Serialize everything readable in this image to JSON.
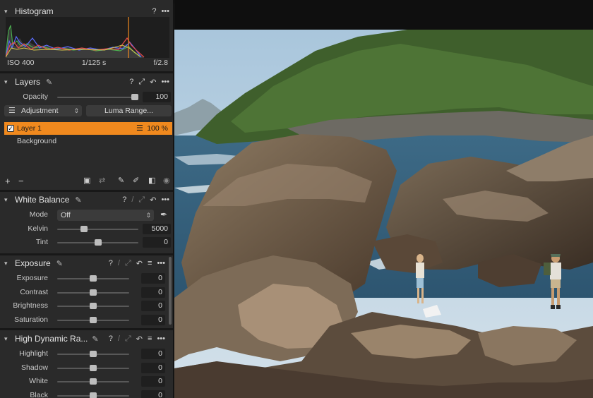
{
  "histogram": {
    "title": "Histogram",
    "iso": "ISO 400",
    "shutter": "1/125 s",
    "aperture": "f/2.8"
  },
  "layers": {
    "title": "Layers",
    "opacity_label": "Opacity",
    "opacity_value": "100",
    "opacity_level": 1.0,
    "adjustment_label": "Adjustment",
    "luma_label": "Luma Range...",
    "items": [
      {
        "name": "Layer 1",
        "value": "100 %",
        "active": true,
        "checked": true
      },
      {
        "name": "Background",
        "active": false
      }
    ]
  },
  "white_balance": {
    "title": "White Balance",
    "mode_label": "Mode",
    "mode_value": "Off",
    "kelvin_label": "Kelvin",
    "kelvin_value": "5000",
    "kelvin_level": 0.33,
    "tint_label": "Tint",
    "tint_value": "0",
    "tint_level": 0.5
  },
  "exposure": {
    "title": "Exposure",
    "rows": [
      {
        "label": "Exposure",
        "value": "0",
        "level": 0.5
      },
      {
        "label": "Contrast",
        "value": "0",
        "level": 0.5
      },
      {
        "label": "Brightness",
        "value": "0",
        "level": 0.5
      },
      {
        "label": "Saturation",
        "value": "0",
        "level": 0.5
      }
    ]
  },
  "hdr": {
    "title": "High Dynamic Ra...",
    "rows": [
      {
        "label": "Highlight",
        "value": "0",
        "level": 0.5
      },
      {
        "label": "Shadow",
        "value": "0",
        "level": 0.5
      },
      {
        "label": "White",
        "value": "0",
        "level": 0.5
      },
      {
        "label": "Black",
        "value": "0",
        "level": 0.5
      }
    ]
  },
  "icons": {
    "help": "?",
    "more": "•••",
    "chevron": "▾"
  },
  "colors": {
    "accent": "#f0891e",
    "panel": "#2a2a2a",
    "field": "#1f1f1f"
  }
}
